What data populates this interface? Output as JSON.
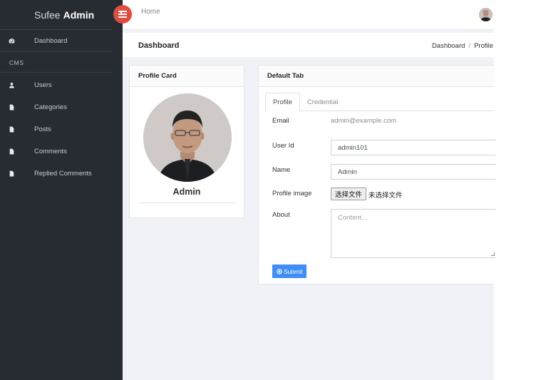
{
  "app": {
    "brand_light": "Sufee",
    "brand_bold": "Admin"
  },
  "sidebar": {
    "items": [
      {
        "label": "Dashboard",
        "icon": "dashboard-icon"
      },
      {
        "label": "Users",
        "icon": "user-icon"
      },
      {
        "label": "Categories",
        "icon": "file-icon"
      },
      {
        "label": "Posts",
        "icon": "file-icon"
      },
      {
        "label": "Comments",
        "icon": "file-icon"
      },
      {
        "label": "Replied Comments",
        "icon": "file-icon"
      }
    ],
    "section_label": "CMS"
  },
  "topbar": {
    "home": "Home"
  },
  "page": {
    "title": "Dashboard",
    "breadcrumb": [
      "Dashboard",
      "Profile"
    ]
  },
  "profile_card": {
    "title": "Profile Card",
    "name": "Admin"
  },
  "tab_card": {
    "title": "Default Tab",
    "tabs": [
      {
        "label": "Profile",
        "active": true
      },
      {
        "label": "Credential",
        "active": false
      }
    ],
    "fields": {
      "email_label": "Email",
      "email_value": "admin@example.com",
      "userid_label": "User Id",
      "userid_value": "admin101",
      "name_label": "Name",
      "name_value": "Admin",
      "image_label": "Profile image",
      "file_button": "选择文件",
      "file_status": "未选择文件",
      "about_label": "About",
      "about_placeholder": "Content..."
    },
    "submit_label": "Submit"
  },
  "colors": {
    "sidebar": "#272c33",
    "accent_red": "#e24c3f",
    "primary": "#3f8ef7",
    "background": "#f1f2f7"
  }
}
